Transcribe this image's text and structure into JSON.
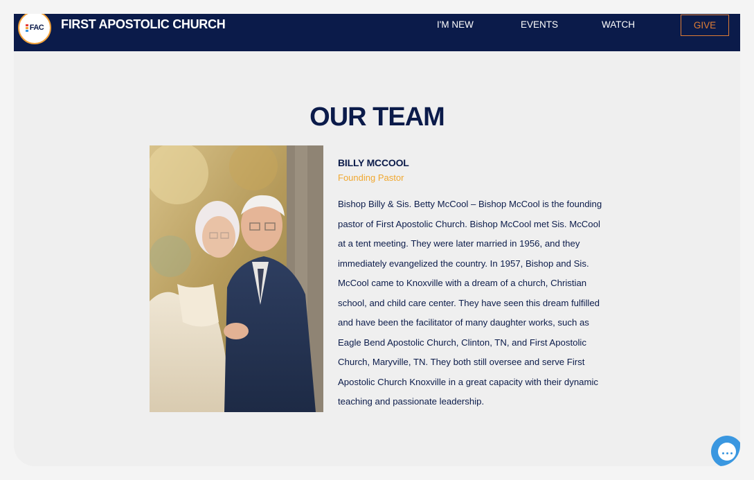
{
  "header": {
    "logo_text": "FAC",
    "site_title": "FIRST APOSTOLIC CHURCH",
    "nav": [
      {
        "label": "I'M NEW"
      },
      {
        "label": "EVENTS"
      },
      {
        "label": "WATCH"
      }
    ],
    "give_label": "GIVE"
  },
  "main": {
    "section_title": "OUR TEAM",
    "member": {
      "name": "BILLY MCCOOL",
      "role": "Founding Pastor",
      "bio": "Bishop Billy & Sis. Betty McCool – Bishop McCool is the founding pastor of First Apostolic Church. Bishop McCool met Sis. McCool at a tent meeting. They were later married in 1956, and they immediately evangelized the country. In 1957, Bishop and Sis. McCool came to Knoxville with a dream of a church, Christian school, and child care center. They have seen this dream fulfilled and have been the facilitator of many daughter works, such as Eagle Bend Apostolic Church, Clinton, TN, and First Apostolic Church, Maryville, TN. They both still oversee and serve First Apostolic Church Knoxville in a great capacity with their dynamic teaching and passionate leadership."
    }
  },
  "chat": {
    "icon": "chat-bubble-icon"
  },
  "colors": {
    "navy": "#0b1b4a",
    "accent_orange": "#e07d35",
    "role_gold": "#f0a830",
    "chat_blue": "#3a97e0"
  }
}
